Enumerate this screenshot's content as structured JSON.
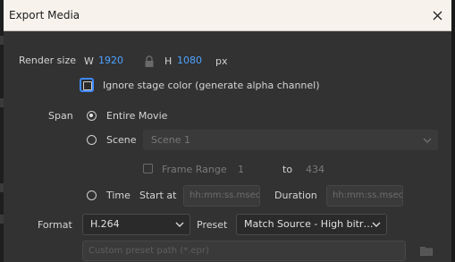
{
  "window": {
    "title": "Export Media"
  },
  "render_size": {
    "label": "Render size",
    "w_label": "W",
    "w_value": "1920",
    "h_label": "H",
    "h_value": "1080",
    "unit": "px"
  },
  "ignore_stage": {
    "label": "Ignore stage color (generate alpha channel)",
    "checked": false
  },
  "span": {
    "label": "Span",
    "entire_movie": "Entire Movie",
    "scene_label": "Scene",
    "scene_value": "Scene 1",
    "frame_range_label": "Frame Range",
    "frame_from": "1",
    "to_label": "to",
    "frame_to": "434",
    "time_label": "Time",
    "start_at_label": "Start at",
    "start_placeholder": "hh:mm:ss.msec",
    "duration_label": "Duration",
    "duration_placeholder": "hh:mm:ss.msec"
  },
  "format": {
    "label": "Format",
    "value": "H.264",
    "preset_label": "Preset",
    "preset_value": "Match Source - High bitr…",
    "custom_preset_placeholder": "Custom preset path (*.epr)"
  },
  "colors": {
    "accent": "#4da3ff",
    "focus": "#3f89ff"
  }
}
